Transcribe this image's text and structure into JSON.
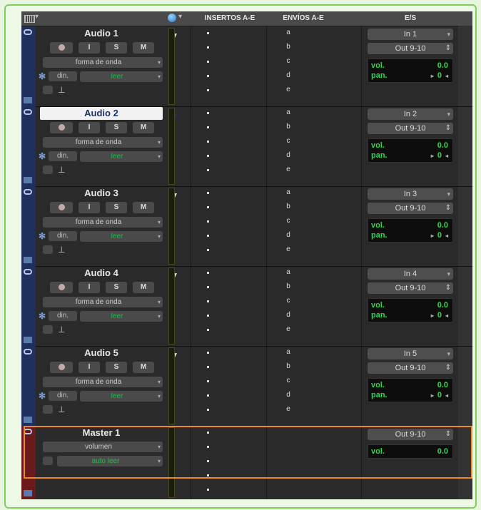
{
  "header": {
    "inserts": "INSERTOS A-E",
    "sends": "ENVÍOS A-E",
    "io": "E/S"
  },
  "buttons": {
    "input": "I",
    "solo": "S",
    "mute": "M"
  },
  "send_letters": [
    "a",
    "b",
    "c",
    "d",
    "e"
  ],
  "tracks": [
    {
      "name": "Audio 1",
      "view": "forma de onda",
      "auto_mode": "din.",
      "auto": "leer",
      "input": "In 1",
      "output": "Out 9-10",
      "vol_label": "vol.",
      "vol": "0.0",
      "pan_label": "pan.",
      "pan": "0"
    },
    {
      "name": "Audio 2",
      "view": "forma de onda",
      "auto_mode": "din.",
      "auto": "leer",
      "input": "In 2",
      "output": "Out 9-10",
      "vol_label": "vol.",
      "vol": "0.0",
      "pan_label": "pan.",
      "pan": "0"
    },
    {
      "name": "Audio 3",
      "view": "forma de onda",
      "auto_mode": "din.",
      "auto": "leer",
      "input": "In 3",
      "output": "Out 9-10",
      "vol_label": "vol.",
      "vol": "0.0",
      "pan_label": "pan.",
      "pan": "0"
    },
    {
      "name": "Audio 4",
      "view": "forma de onda",
      "auto_mode": "din.",
      "auto": "leer",
      "input": "In 4",
      "output": "Out 9-10",
      "vol_label": "vol.",
      "vol": "0.0",
      "pan_label": "pan.",
      "pan": "0"
    },
    {
      "name": "Audio 5",
      "view": "forma de onda",
      "auto_mode": "din.",
      "auto": "leer",
      "input": "In 5",
      "output": "Out 9-10",
      "vol_label": "vol.",
      "vol": "0.0",
      "pan_label": "pan.",
      "pan": "0"
    }
  ],
  "master": {
    "name": "Master 1",
    "view": "volumen",
    "auto": "auto leer",
    "output": "Out 9-10",
    "vol_label": "vol.",
    "vol": "0.0"
  },
  "colors": {
    "audio_track": "#1f2f5e",
    "master_track": "#6a1a1a",
    "value_green": "#31d64b",
    "highlight": "#ee8a2a"
  }
}
